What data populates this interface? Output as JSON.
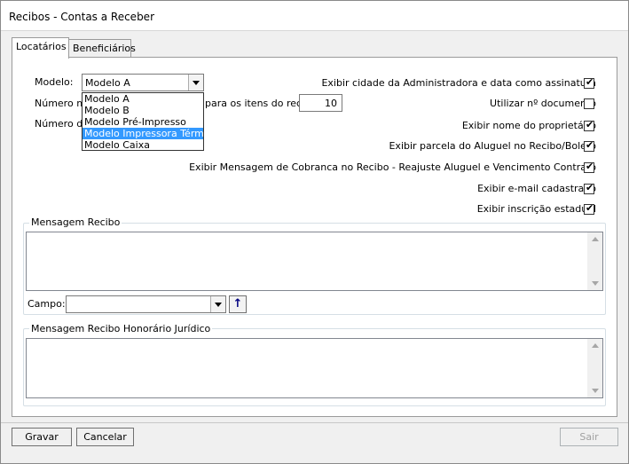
{
  "window": {
    "title": "Recibos - Contas a Receber"
  },
  "tabs": [
    {
      "label": "Locatários",
      "active": true
    },
    {
      "label": "Beneficiários",
      "active": false
    }
  ],
  "form": {
    "modelo_label": "Modelo:",
    "modelo_value": "Modelo A",
    "modelo_options": [
      "Modelo A",
      "Modelo B",
      "Modelo Pré-Impresso",
      "Modelo Impressora Térmica",
      "Modelo Caixa"
    ],
    "modelo_highlighted": "Modelo Impressora Térmica",
    "numero_label_left": "Número mí",
    "numero_label_right": "para os itens do recib",
    "numero_value": "10",
    "numero2_label": "Número de"
  },
  "options": [
    {
      "label": "Exibir cidade da Administradora e data como assinatura",
      "checked": true
    },
    {
      "label": "Utilizar nº documento",
      "checked": false
    },
    {
      "label": "Exibir nome do proprietário",
      "checked": true
    },
    {
      "label": "Exibir parcela do Aluguel no Recibo/Boleto",
      "checked": true
    },
    {
      "label": "Exibir Mensagem de Cobranca no Recibo - Reajuste Aluguel e Vencimento Contrato",
      "checked": true
    },
    {
      "label": "Exibir e-mail cadastrado",
      "checked": true
    },
    {
      "label": "Exibir inscrição estadual",
      "checked": true
    }
  ],
  "mensagem_recibo": {
    "title": "Mensagem Recibo",
    "text": "",
    "campo_label": "Campo:",
    "campo_value": "",
    "up_arrow": "↑"
  },
  "mensagem_honorario": {
    "title": "Mensagem Recibo Honorário Jurídico",
    "text": ""
  },
  "buttons": {
    "gravar": "Gravar",
    "cancelar": "Cancelar",
    "sair": "Sair"
  },
  "icons": {
    "check": "✔",
    "dropdown": "chevron-down-icon",
    "scroll_up": "scroll-up-icon",
    "scroll_down": "scroll-down-icon"
  }
}
